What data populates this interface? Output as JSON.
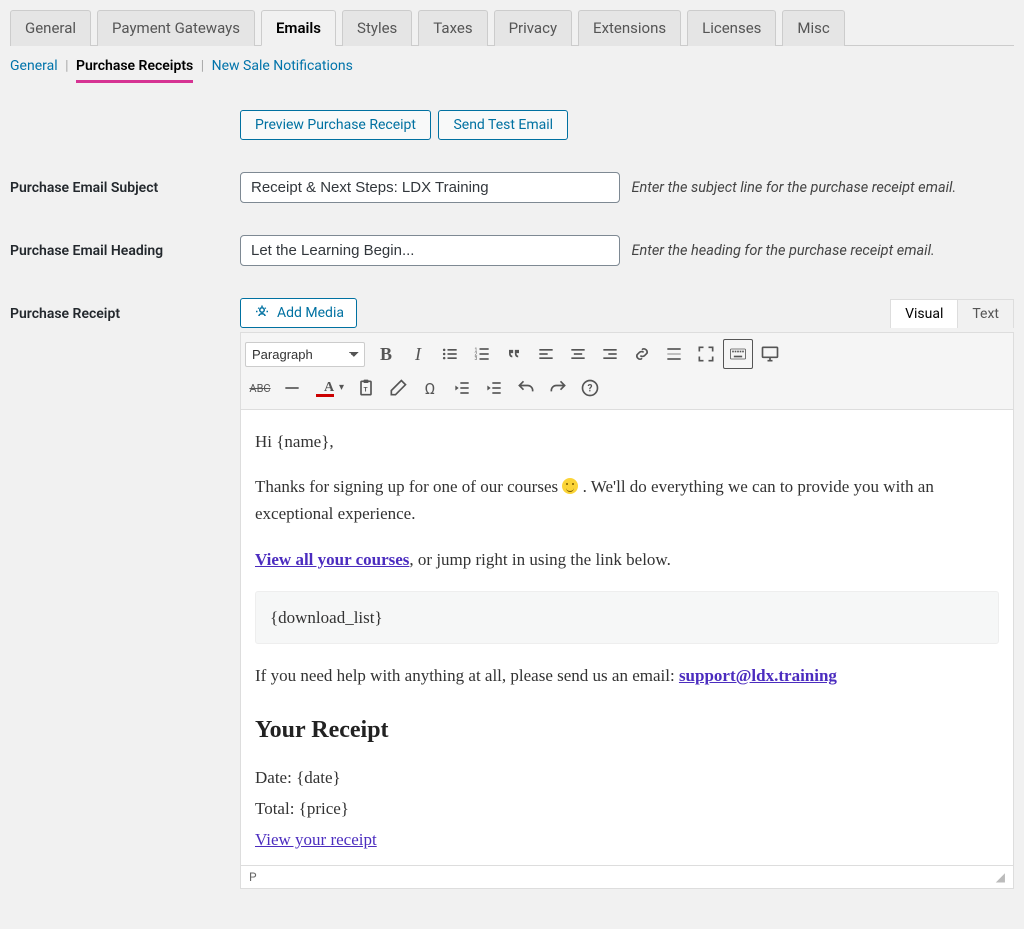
{
  "tabs": {
    "general": "General",
    "gateways": "Payment Gateways",
    "emails": "Emails",
    "styles": "Styles",
    "taxes": "Taxes",
    "privacy": "Privacy",
    "extensions": "Extensions",
    "licenses": "Licenses",
    "misc": "Misc"
  },
  "subnav": {
    "general": "General",
    "receipts": "Purchase Receipts",
    "newsale": "New Sale Notifications",
    "sep": "|"
  },
  "buttons": {
    "preview": "Preview Purchase Receipt",
    "sendtest": "Send Test Email",
    "addmedia": "Add Media"
  },
  "labels": {
    "subject": "Purchase Email Subject",
    "heading": "Purchase Email Heading",
    "receipt": "Purchase Receipt"
  },
  "fields": {
    "subject_value": "Receipt & Next Steps: LDX Training",
    "subject_hint": "Enter the subject line for the purchase receipt email.",
    "heading_value": "Let the Learning Begin...",
    "heading_hint": "Enter the heading for the purchase receipt email."
  },
  "editor": {
    "visual": "Visual",
    "text": "Text",
    "format_label": "Paragraph",
    "status_path": "P",
    "abc": "ABC",
    "omega": "Ω"
  },
  "content": {
    "greeting": "Hi {name},",
    "p1a": "Thanks for signing up for one of our courses ",
    "p1b": " . We'll do everything we can to provide you with an exceptional experience.",
    "view_courses_link": "View all your courses",
    "p2_rest": ", or jump right in using the link below.",
    "download_token": "{download_list}",
    "help_pre": "If you need help with anything at all, please send us an email: ",
    "help_email": "support@ldx.training",
    "receipt_heading": "Your Receipt",
    "date_line": "Date: {date}",
    "total_line": "Total: {price}",
    "view_receipt_link": "View your receipt"
  }
}
